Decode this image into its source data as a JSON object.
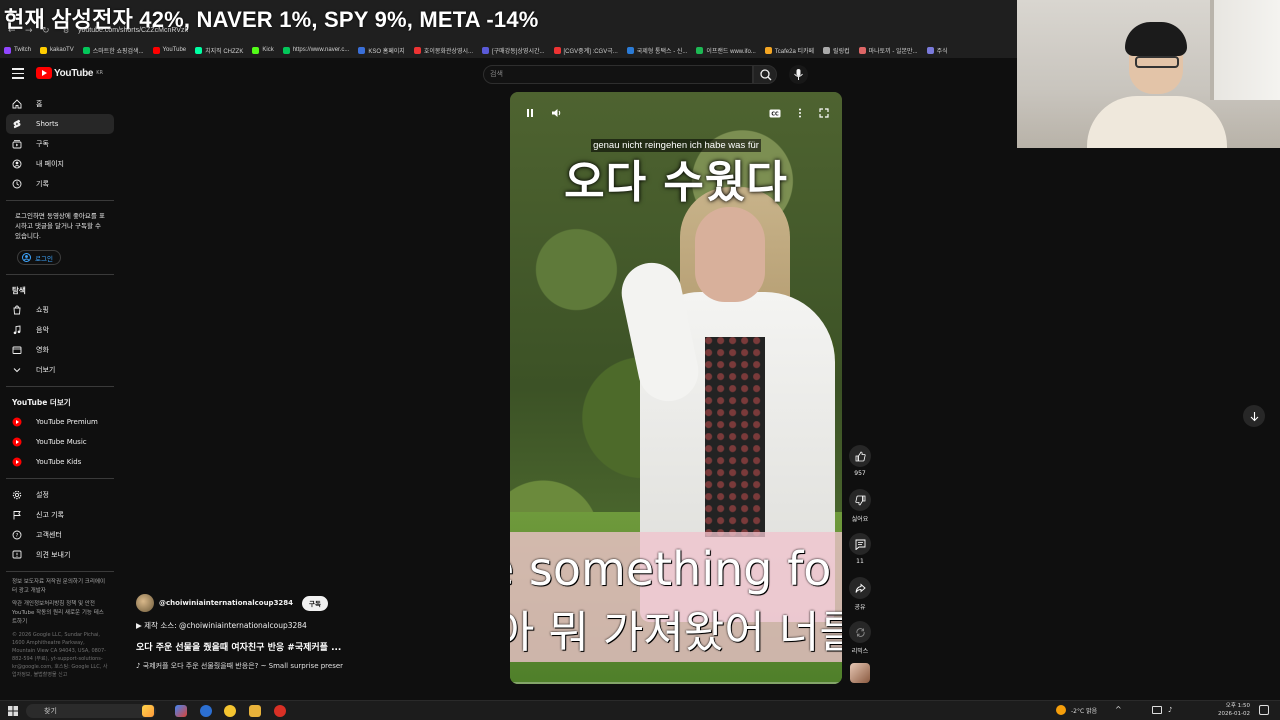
{
  "browser": {
    "ticker": "현재 삼성전자 42%, NAVER 1%, SPY 9%, META -14%",
    "url": "youtube.com/shorts/CZZcMcnRVzk",
    "bookmarks": [
      {
        "label": "Twitch",
        "color": "#9146ff"
      },
      {
        "label": "kakaoTV",
        "color": "#ffcd00"
      },
      {
        "label": "스마트한 쇼핑검색...",
        "color": "#03c75a"
      },
      {
        "label": "YouTube",
        "color": "#ff0000"
      },
      {
        "label": "치지직 CHZZK",
        "color": "#00ffa3"
      },
      {
        "label": "Kick",
        "color": "#53fc18"
      },
      {
        "label": "https://www.naver.c...",
        "color": "#03c75a"
      },
      {
        "label": "KSO 홈페이지",
        "color": "#3a6fd8"
      },
      {
        "label": "호이몽화관상영시...",
        "color": "#e33"
      },
      {
        "label": "[구매강동]상영시간...",
        "color": "#5a5ad8"
      },
      {
        "label": "[CGV중계] :CGV극...",
        "color": "#e33"
      },
      {
        "label": "국제형 통택스 - 신...",
        "color": "#2b7bd6"
      },
      {
        "label": "이프랜드 www.ifo...",
        "color": "#1db954"
      },
      {
        "label": "Tcafe2a 티카페",
        "color": "#f5a623"
      },
      {
        "label": "릴링컵",
        "color": "#aaa"
      },
      {
        "label": "마나토끼 - 일본만...",
        "color": "#d66"
      },
      {
        "label": "주식",
        "color": "#7a7adb"
      }
    ]
  },
  "header": {
    "logo_text": "YouTube",
    "logo_region": "KR",
    "search_placeholder": "검색"
  },
  "sidebar": {
    "main": [
      {
        "label": "홈",
        "icon": "home-icon"
      },
      {
        "label": "Shorts",
        "icon": "shorts-icon",
        "active": true
      },
      {
        "label": "구독",
        "icon": "subscriptions-icon"
      },
      {
        "label": "내 페이지",
        "icon": "you-icon"
      },
      {
        "label": "기록",
        "icon": "history-icon"
      }
    ],
    "login_note": "로그인하면 동영상에 좋아요를 표시하고 댓글을 달거나 구독할 수 있습니다.",
    "login_label": "로그인",
    "explore_heading": "탐색",
    "explore": [
      {
        "label": "쇼핑",
        "icon": "shopping-icon"
      },
      {
        "label": "음악",
        "icon": "music-icon"
      },
      {
        "label": "영화",
        "icon": "movies-icon"
      },
      {
        "label": "더보기",
        "icon": "chevron-down-icon"
      }
    ],
    "more_heading": "YouTube 더보기",
    "more": [
      {
        "label": "YouTube Premium"
      },
      {
        "label": "YouTube Music"
      },
      {
        "label": "YouTube Kids"
      }
    ],
    "settings": [
      {
        "label": "설정",
        "icon": "gear-icon"
      },
      {
        "label": "신고 기록",
        "icon": "flag-icon"
      },
      {
        "label": "고객센터",
        "icon": "help-icon"
      },
      {
        "label": "의견 보내기",
        "icon": "feedback-icon"
      }
    ],
    "footer_links_1": "정보  보도자료  저작권  문의하기  크리에이터  광고  개발자",
    "footer_links_2": "약관  개인정보처리방침  정책 및 안전  YouTube 작동의 원리  새로운 기능 테스트하기",
    "footer_copy": "© 2026 Google LLC, Sundar Pichai, 1600 Amphitheatre Parkway, Mountain View CA 94043, USA, 0807-882-594 (무료), yt-support-solutions-kr@google.com, 호스팅: Google LLC, 사업자정보, 불법촬영물 신고"
  },
  "video": {
    "caption_top": "genau nicht reingehen ich habe was für",
    "title_overlay": "오다 수웠다",
    "subtitle_en": "e something fo",
    "subtitle_ko": "아 뭐 가져왔어 너를",
    "progress": 0.0
  },
  "channel": {
    "handle": "@choiwiniainternationalcoup3284",
    "subscribe_label": "구독",
    "source_line": "▶ 제작 소스: @choiwiniainternationalcoup3284",
    "title": "오다 주운 선물을 줬을때 여자친구 반응 #국제커플 ...",
    "music_line": "♪ 국제커플 오다 주운 선물줬을때 반응은? ~ Small surprise preser"
  },
  "actions": {
    "like_count": "957",
    "dislike_label": "싫어요",
    "comment_count": "11",
    "share_label": "공유",
    "remix_label": "리믹스"
  },
  "taskbar": {
    "search_label": "찾기",
    "weather": "-2°C 맑음",
    "time": "오후 1:50",
    "date": "2026-01-02"
  },
  "colors": {
    "accent": "#ff0000",
    "link": "#3ea6ff",
    "background": "#0f0f0f"
  }
}
